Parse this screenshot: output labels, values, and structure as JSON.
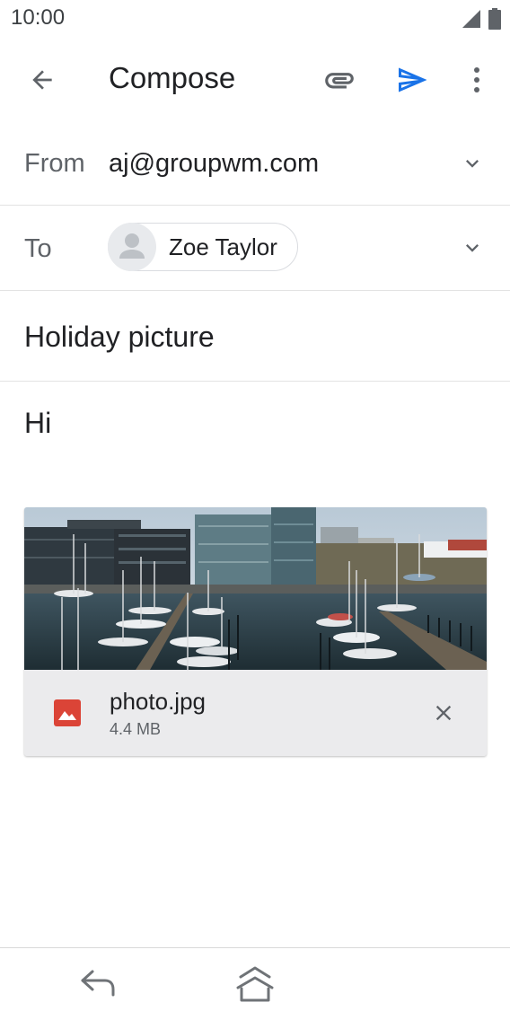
{
  "status_bar": {
    "time": "10:00"
  },
  "app_bar": {
    "title": "Compose",
    "icons": {
      "back": "arrow-back-icon",
      "attach": "paperclip-icon",
      "send": "send-icon",
      "more": "more-vert-icon"
    },
    "accent_color": "#1a73e8"
  },
  "from": {
    "label": "From",
    "value": "aj@groupwm.com"
  },
  "to": {
    "label": "To",
    "recipients": [
      {
        "name": "Zoe Taylor"
      }
    ]
  },
  "subject": "Holiday picture",
  "body": "Hi",
  "attachment": {
    "file_name": "photo.jpg",
    "file_size": "4.4 MB",
    "icon_color": "#db4437"
  },
  "nav_bar": {
    "icons": [
      "nav-back-icon",
      "nav-home-icon"
    ]
  }
}
